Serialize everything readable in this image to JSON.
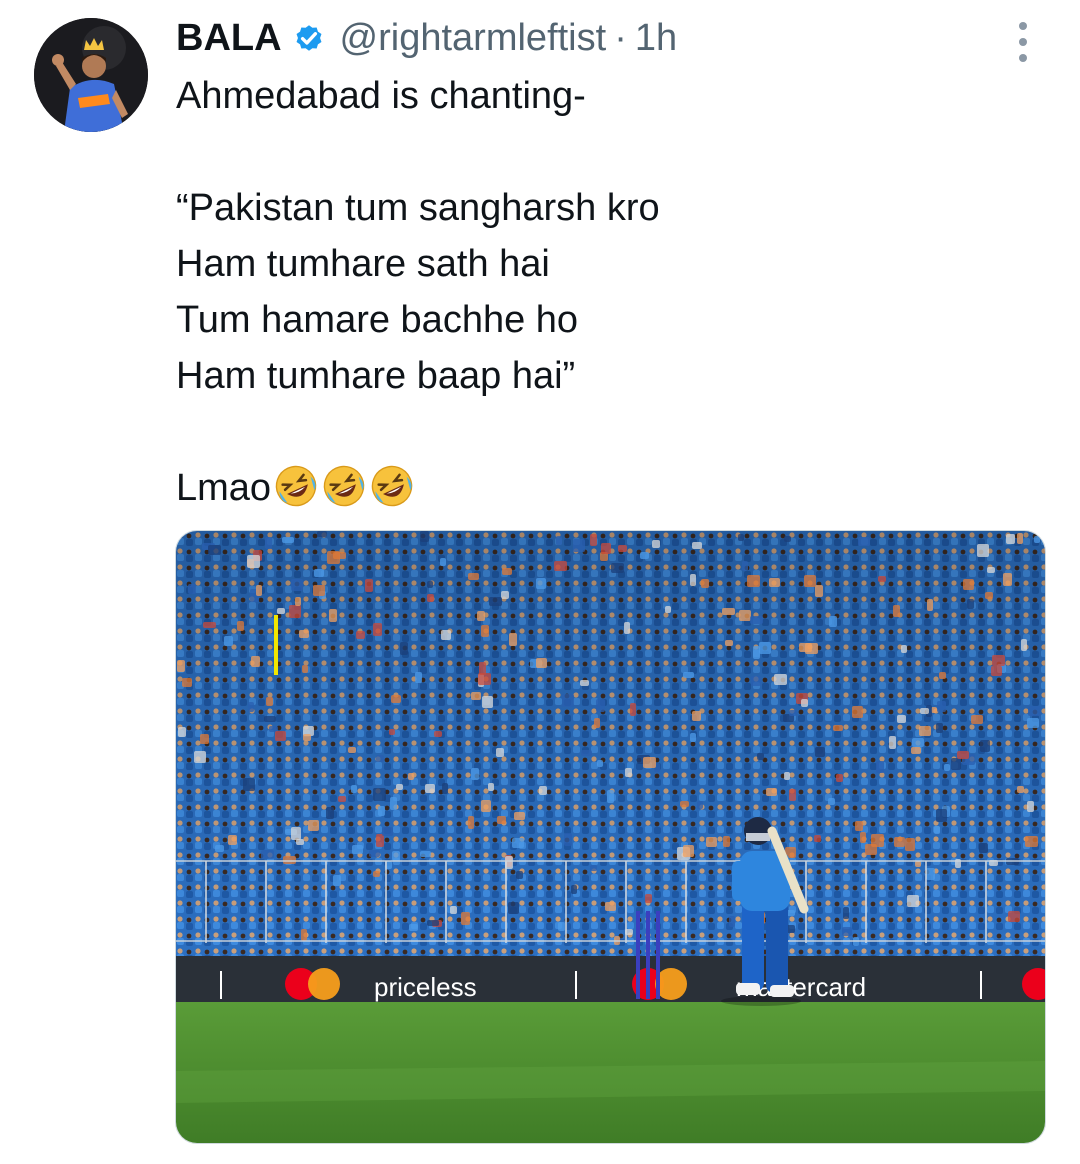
{
  "tweet": {
    "author": {
      "display_name": "BALA",
      "handle": "@rightarmleftist",
      "verified": true,
      "avatar_icon": "cricketer-avatar"
    },
    "separator": "·",
    "time": "1h",
    "text_lines": [
      "Ahmedabad is chanting-",
      "",
      "“Pakistan tum sangharsh kro",
      "Ham tumhare sath hai",
      "Tum hamare bachhe ho",
      "Ham tumhare baap hai”",
      "",
      "Lmao"
    ],
    "emojis": [
      "rolling-on-floor-laughing",
      "rolling-on-floor-laughing",
      "rolling-on-floor-laughing"
    ],
    "media": {
      "description_icon": "cricket-stadium-photo",
      "boundary_board_texts": [
        "priceless",
        "mastercard"
      ]
    }
  },
  "colors": {
    "text_primary": "#0f1419",
    "text_secondary": "#536471",
    "verified_blue": "#1d9bf0",
    "crowd_blue": "#2f77c8",
    "pitch_green": "#4a8a2e"
  },
  "icons": {
    "verified": "verified-badge-icon",
    "more": "more-options-icon"
  }
}
